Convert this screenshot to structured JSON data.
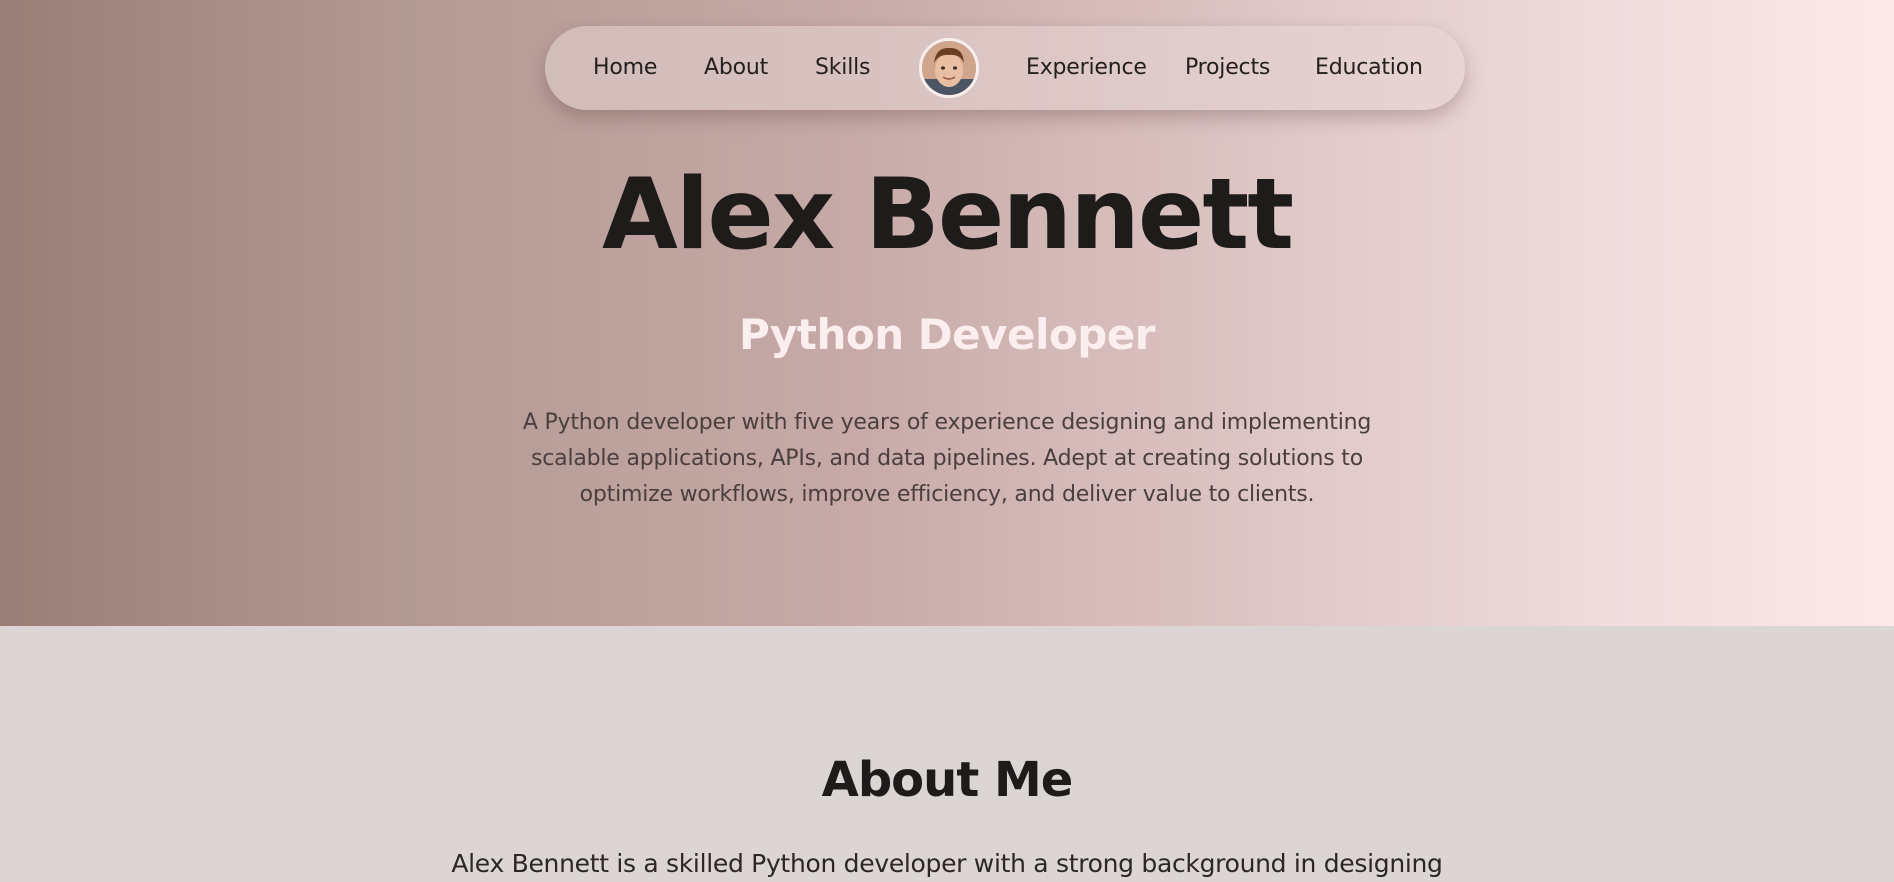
{
  "nav": {
    "items": [
      {
        "label": "Home"
      },
      {
        "label": "About"
      },
      {
        "label": "Skills"
      },
      {
        "label": "Experience"
      },
      {
        "label": "Projects"
      },
      {
        "label": "Education"
      }
    ],
    "avatar_icon": "profile-photo"
  },
  "hero": {
    "name": "Alex Bennett",
    "role": "Python Developer",
    "intro": "A Python developer with five years of experience designing and implementing scalable applications, APIs, and data pipelines. Adept at creating solutions to optimize workflows, improve efficiency, and deliver value to clients."
  },
  "about": {
    "title": "About Me",
    "body": "Alex Bennett is a skilled Python developer with a strong background in designing"
  },
  "colors": {
    "hero_gradient_start": "#9a7e76",
    "hero_gradient_end": "#fde9e9",
    "role_text": "#fbeeee",
    "section_background": "#dbd5d5"
  }
}
